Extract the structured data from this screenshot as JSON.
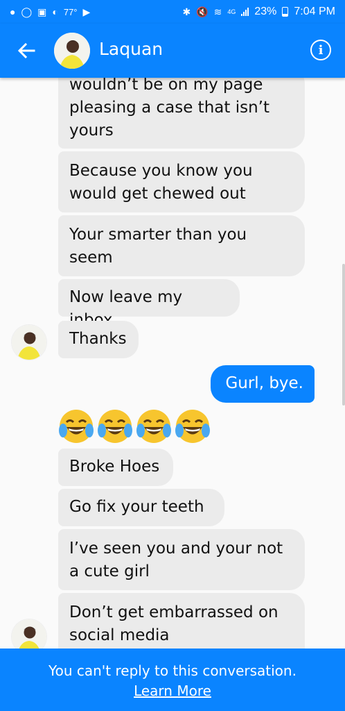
{
  "status_bar": {
    "temperature": "77°",
    "network": "4G",
    "battery": "23%",
    "time": "7:04 PM"
  },
  "header": {
    "name": "Laquan"
  },
  "messages": [
    {
      "direction": "in",
      "text": "wouldn’t be on my page pleasing a case that isn’t yours"
    },
    {
      "direction": "in",
      "text": "Because you know you would get chewed out"
    },
    {
      "direction": "in",
      "text": "Your smarter than you seem"
    },
    {
      "direction": "in",
      "text": "Now leave my inbox"
    },
    {
      "direction": "in",
      "text": "Thanks"
    },
    {
      "direction": "out",
      "text": "Gurl, bye."
    },
    {
      "direction": "in",
      "text": "😂😂😂😂"
    },
    {
      "direction": "in",
      "text": "Broke Hoes"
    },
    {
      "direction": "in",
      "text": "Go fix your teeth"
    },
    {
      "direction": "in",
      "text": "I’ve seen you and your not a cute girl"
    },
    {
      "direction": "in",
      "text": "Don’t get embarrassed on social media"
    }
  ],
  "footer": {
    "notice": "You can't reply to this conversation.",
    "link": "Learn More"
  },
  "colors": {
    "accent": "#0a84ff",
    "incoming_bubble": "#ebebeb"
  },
  "icons": [
    "back-arrow-icon",
    "info-icon",
    "bluetooth-icon",
    "mute-icon",
    "wifi-icon",
    "signal-icon",
    "battery-icon"
  ]
}
